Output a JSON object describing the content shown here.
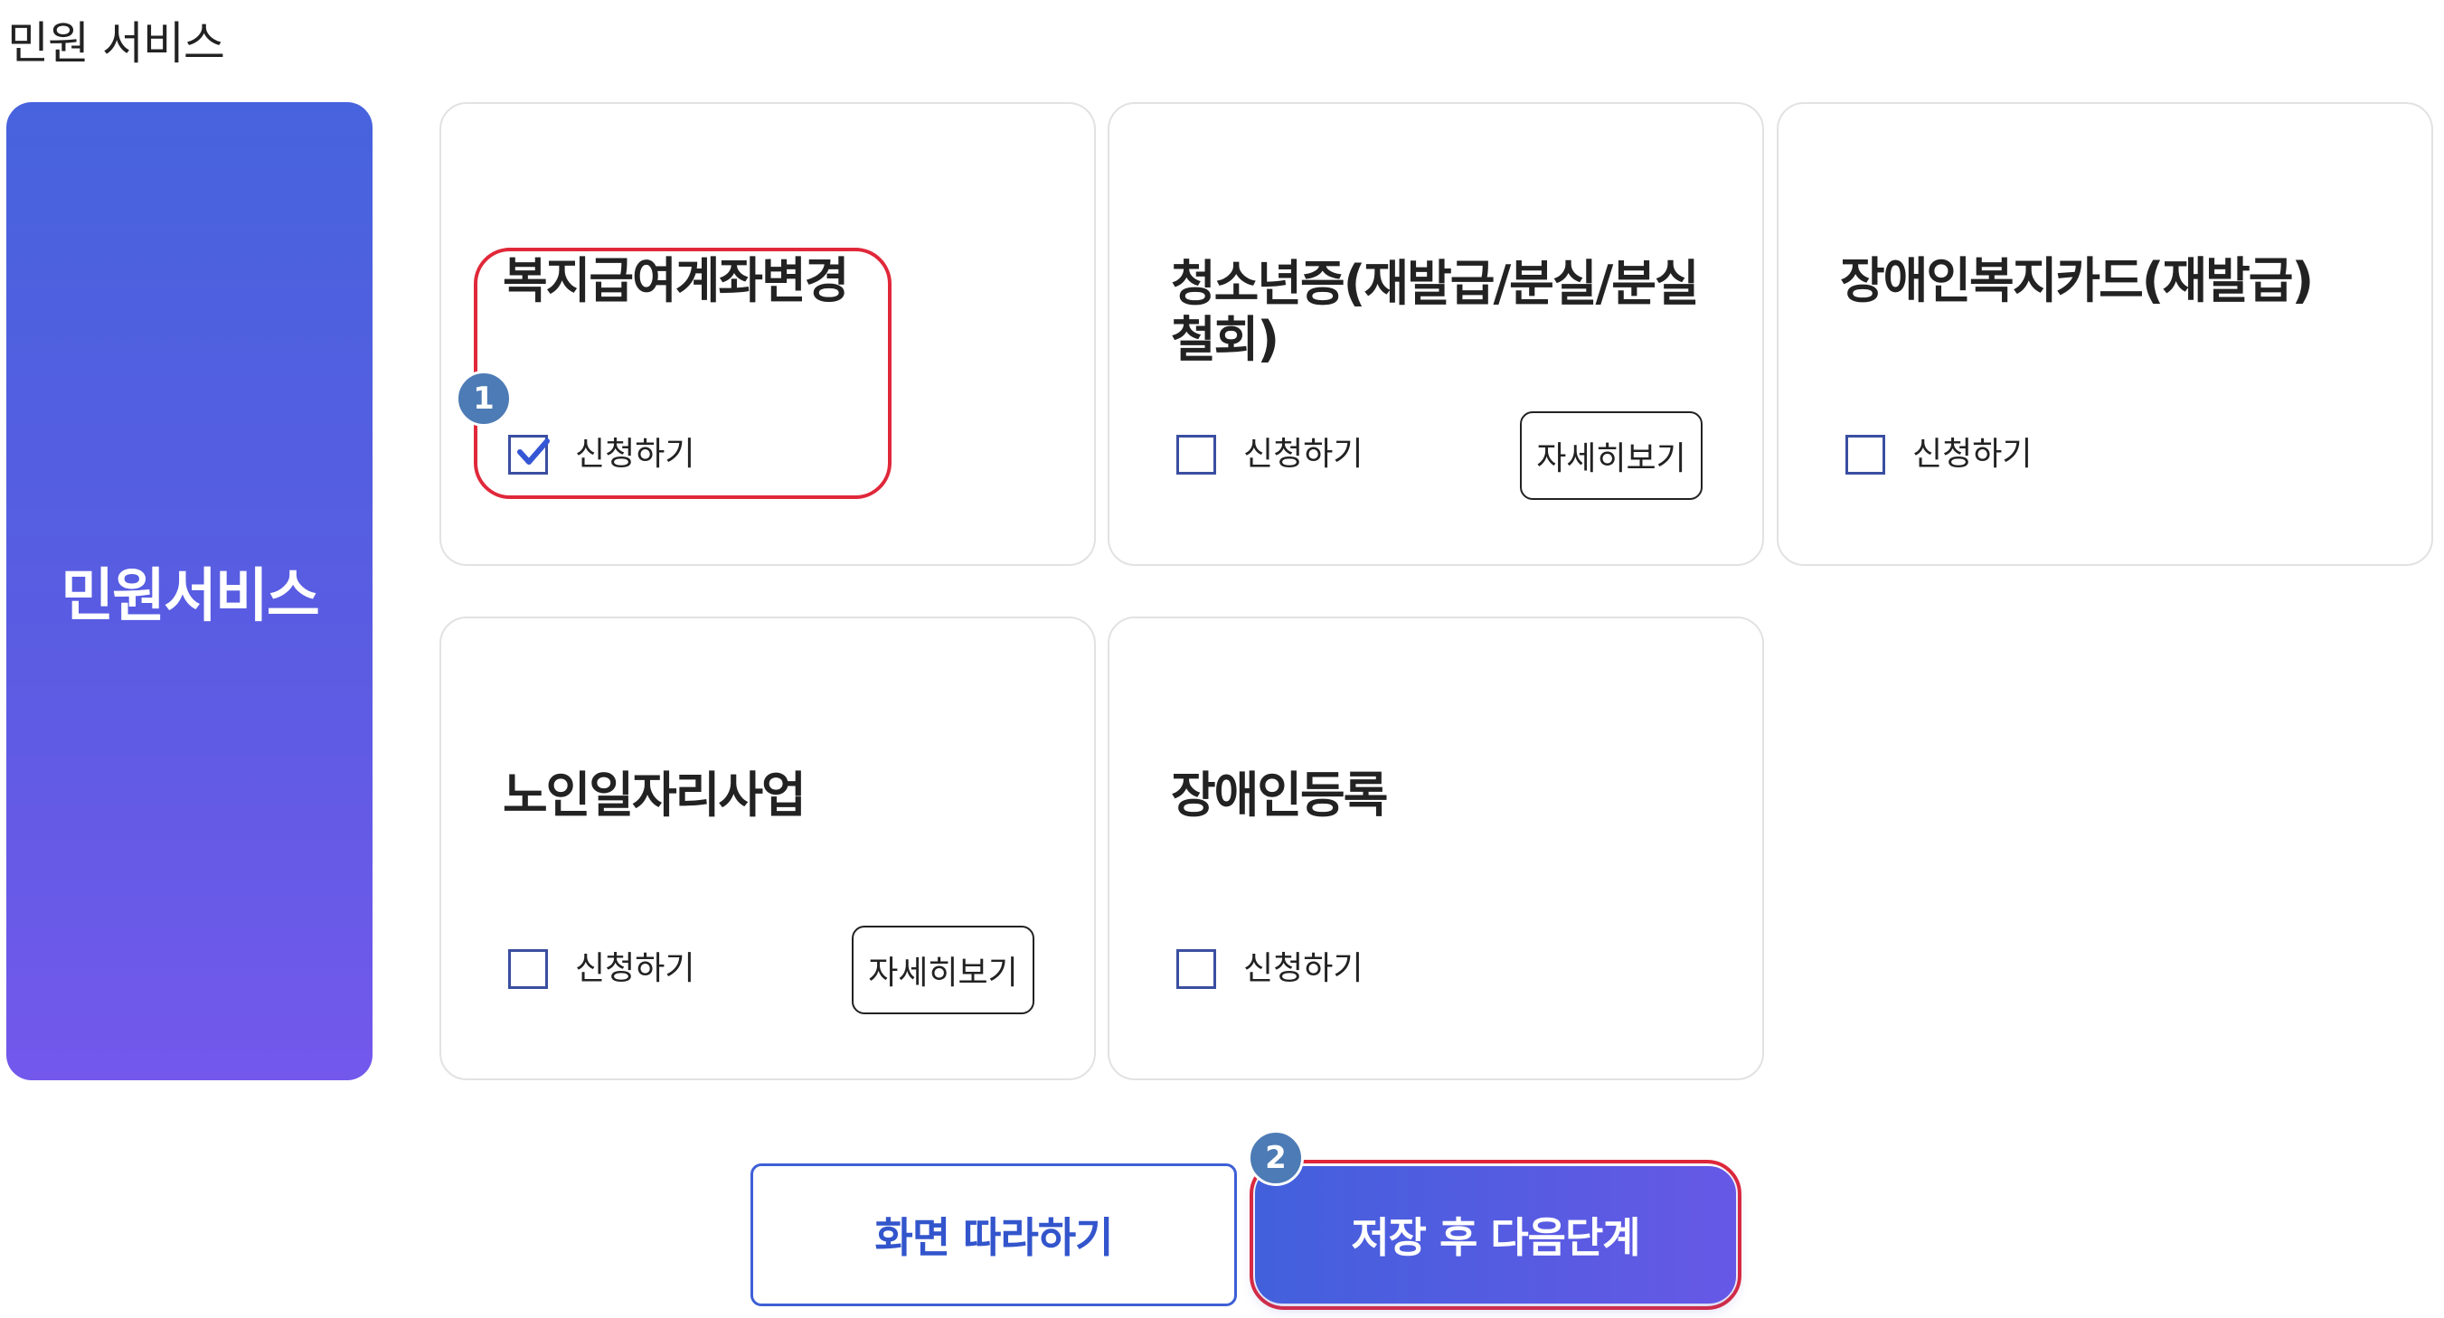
{
  "section_title": "민원 서비스",
  "side_panel_label": "민원서비스",
  "cards": [
    {
      "title": "복지급여계좌변경",
      "apply_label": "신청하기",
      "checked": true
    },
    {
      "title": "청소년증(재발급/분실/분실철회)",
      "title_line1": "청소년증(재발급/분실/분실",
      "title_line2": "철회)",
      "apply_label": "신청하기",
      "checked": false,
      "detail_label": "자세히보기"
    },
    {
      "title": "장애인복지카드(재발급)",
      "apply_label": "신청하기",
      "checked": false
    },
    {
      "title": "노인일자리사업",
      "apply_label": "신청하기",
      "checked": false,
      "detail_label": "자세히보기"
    },
    {
      "title": "장애인등록",
      "apply_label": "신청하기",
      "checked": false
    }
  ],
  "step_badges": [
    "1",
    "2"
  ],
  "buttons": {
    "follow_label": "화면 따라하기",
    "next_label": "저장 후 다음단계"
  },
  "colors": {
    "accent": "#4763dd",
    "accent_end": "#7358ec",
    "highlight": "#e0283a",
    "badge": "#4d7bb5"
  }
}
